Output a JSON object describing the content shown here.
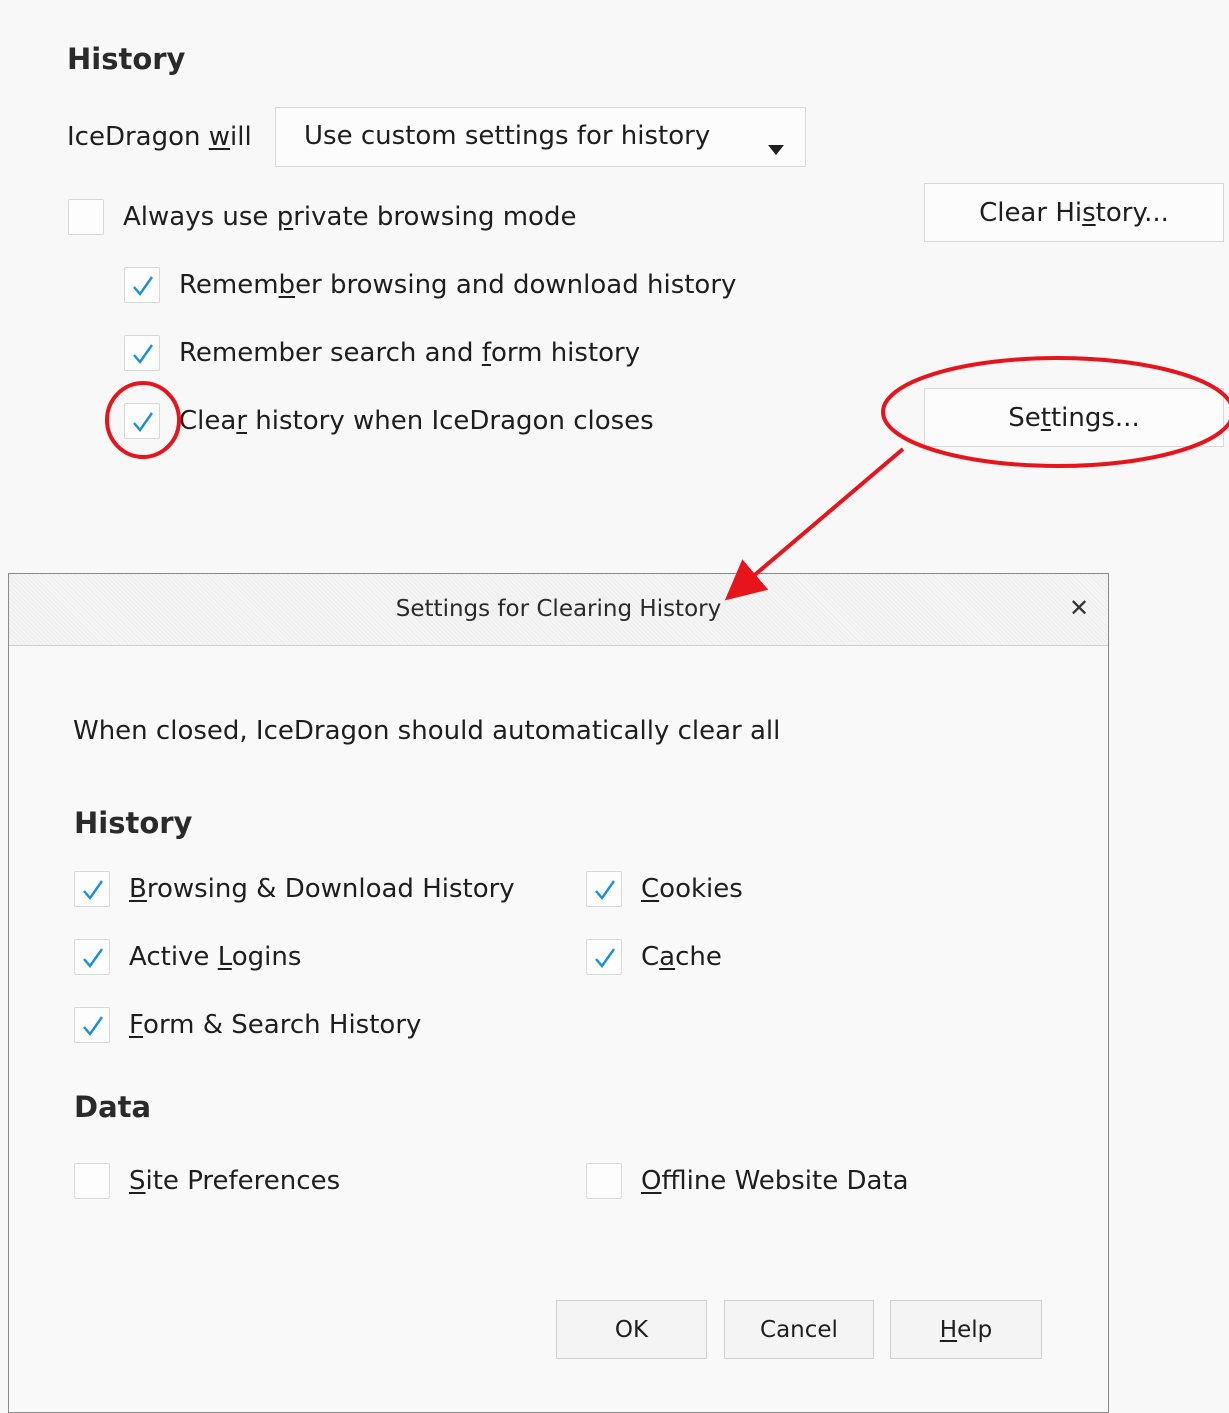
{
  "history": {
    "title": "History",
    "will_label_pre": "IceDragon ",
    "will_label_key": "w",
    "will_label_post": "ill",
    "mode_select": {
      "value": "Use custom settings for history"
    },
    "private_mode": {
      "pre": "Always use ",
      "key": "p",
      "post": "rivate browsing mode",
      "checked": false
    },
    "clear_history_button": {
      "pre": "Clear Hi",
      "key": "s",
      "post": "tory..."
    },
    "remember_browsing": {
      "pre": "Remem",
      "key": "b",
      "post": "er browsing and download history",
      "checked": true
    },
    "remember_search": {
      "pre": "Remember search and ",
      "key": "f",
      "post": "orm history",
      "checked": true
    },
    "clear_on_close": {
      "pre": "Clea",
      "key": "r",
      "post": " history when IceDragon closes",
      "checked": true
    },
    "settings_button": {
      "pre": "Se",
      "key": "t",
      "post": "tings..."
    }
  },
  "dialog": {
    "title": "Settings for Clearing History",
    "close_glyph": "✕",
    "intro": "When closed, IceDragon should automatically clear all",
    "history_heading": "History",
    "browsing_download": {
      "key": "B",
      "post": "rowsing & Download History",
      "checked": true
    },
    "cookies": {
      "key": "C",
      "post": "ookies",
      "checked": true
    },
    "active_logins": {
      "pre": "Active ",
      "key": "L",
      "post": "ogins",
      "checked": true
    },
    "cache": {
      "pre": "C",
      "key": "a",
      "post": "che",
      "checked": true
    },
    "form_search": {
      "key": "F",
      "post": "orm & Search History",
      "checked": true
    },
    "data_heading": "Data",
    "site_preferences": {
      "key": "S",
      "post": "ite Preferences",
      "checked": false
    },
    "offline_data": {
      "key": "O",
      "post": "ffline Website Data",
      "checked": false
    },
    "ok_label": "OK",
    "cancel_label": "Cancel",
    "help": {
      "key": "H",
      "post": "elp"
    }
  },
  "colors": {
    "check": "#1a90d8",
    "annotation": "#e8141c"
  }
}
